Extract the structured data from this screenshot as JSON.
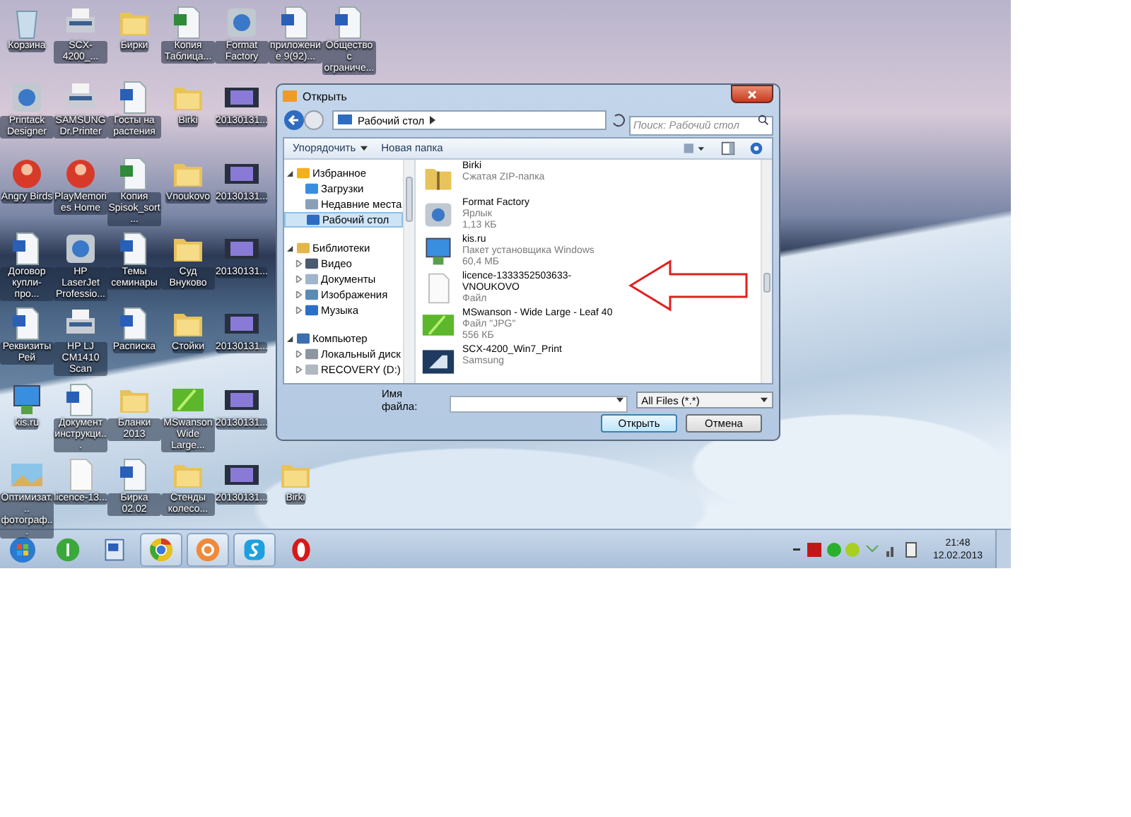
{
  "desktop": {
    "columns": [
      [
        {
          "label": "Корзина",
          "kind": "recycle"
        },
        {
          "label": "Printack Designer",
          "kind": "app"
        },
        {
          "label": "Angry Birds",
          "kind": "game"
        },
        {
          "label": "Договор купли-про...",
          "kind": "word"
        },
        {
          "label": "Реквизиты Рей",
          "kind": "word"
        },
        {
          "label": "kis.ru",
          "kind": "installer"
        },
        {
          "label": "Оптимизат... фотограф...",
          "kind": "image"
        }
      ],
      [
        {
          "label": "SCX-4200_...",
          "kind": "printer"
        },
        {
          "label": "SAMSUNG Dr.Printer",
          "kind": "printer"
        },
        {
          "label": "PlayMemories Home",
          "kind": "game"
        },
        {
          "label": "HP LaserJet Professio...",
          "kind": "app"
        },
        {
          "label": "HP LJ CM1410 Scan",
          "kind": "printer"
        },
        {
          "label": "Документ инструкци...",
          "kind": "word"
        },
        {
          "label": "licence-13...",
          "kind": "file"
        }
      ],
      [
        {
          "label": "Бирки",
          "kind": "folder"
        },
        {
          "label": "Госты на растения",
          "kind": "word"
        },
        {
          "label": "Копия Spisok_sort...",
          "kind": "excel"
        },
        {
          "label": "Темы семинары",
          "kind": "word"
        },
        {
          "label": "Расписка",
          "kind": "word"
        },
        {
          "label": "Бланки 2013",
          "kind": "folder"
        },
        {
          "label": "Бирка 02.02",
          "kind": "word"
        }
      ],
      [
        {
          "label": "Копия Таблица...",
          "kind": "excel"
        },
        {
          "label": "Birki",
          "kind": "folder"
        },
        {
          "label": "Vnoukovo",
          "kind": "folder"
        },
        {
          "label": "Суд Внуково",
          "kind": "folder"
        },
        {
          "label": "Стойки",
          "kind": "folder"
        },
        {
          "label": "MSwanson Wide Large...",
          "kind": "leaf"
        },
        {
          "label": "Стенды колесо...",
          "kind": "folder"
        }
      ],
      [
        {
          "label": "Format Factory",
          "kind": "app"
        },
        {
          "label": "20130131...",
          "kind": "video"
        },
        {
          "label": "20130131...",
          "kind": "video"
        },
        {
          "label": "20130131...",
          "kind": "video"
        },
        {
          "label": "20130131...",
          "kind": "video"
        },
        {
          "label": "20130131...",
          "kind": "video"
        },
        {
          "label": "20130131...",
          "kind": "video"
        }
      ],
      [
        {
          "label": "приложение 9(92)...",
          "kind": "word"
        },
        {
          "label": "Birki",
          "kind": "folder"
        }
      ],
      [
        {
          "label": "Общество с ограниче...",
          "kind": "word"
        }
      ]
    ]
  },
  "dialog": {
    "title": "Открыть",
    "address": "Рабочий стол",
    "search": {
      "placeholder": "Поиск: Рабочий стол"
    },
    "toolbar": [
      {
        "label": "Упорядочить",
        "dropdown": true
      },
      {
        "label": "Новая папка",
        "dropdown": false
      }
    ],
    "nav": [
      {
        "label": "Избранное",
        "kind": "star",
        "expanded": true,
        "selected": false,
        "children": [
          {
            "label": "Загрузки",
            "kind": "download",
            "selected": false
          },
          {
            "label": "Недавние места",
            "kind": "recent",
            "selected": false
          },
          {
            "label": "Рабочий стол",
            "kind": "desktop",
            "selected": true
          }
        ]
      },
      {
        "label": "Библиотеки",
        "kind": "library",
        "expanded": true,
        "selected": false,
        "children": [
          {
            "label": "Видео",
            "kind": "video",
            "selected": false,
            "expanded": false
          },
          {
            "label": "Документы",
            "kind": "docs",
            "selected": false,
            "expanded": false
          },
          {
            "label": "Изображения",
            "kind": "pictures",
            "selected": false,
            "expanded": false
          },
          {
            "label": "Музыка",
            "kind": "music",
            "selected": false,
            "expanded": false
          }
        ]
      },
      {
        "label": "Компьютер",
        "kind": "computer",
        "expanded": true,
        "selected": false,
        "children": [
          {
            "label": "Локальный диск",
            "kind": "disk",
            "selected": false,
            "expanded": false
          },
          {
            "label": "RECOVERY (D:)",
            "kind": "drive",
            "selected": false,
            "expanded": false
          }
        ]
      }
    ],
    "files": [
      {
        "name": "Birki",
        "details": [
          "Сжатая ZIP-папка"
        ],
        "kind": "zip"
      },
      {
        "name": "Format Factory",
        "details": [
          "Ярлык",
          "1,13 КБ"
        ],
        "kind": "shortcut"
      },
      {
        "name": "kis.ru",
        "details": [
          "Пакет установщика Windows",
          "60,4 МБ"
        ],
        "kind": "installer"
      },
      {
        "name": "licence-1333352503633-VNOUKOVO",
        "details": [
          "Файл"
        ],
        "kind": "file"
      },
      {
        "name": "MSwanson - Wide Large - Leaf 40",
        "details": [
          "Файл \"JPG\"",
          "556 КБ"
        ],
        "kind": "leaf"
      },
      {
        "name": "SCX-4200_Win7_Print",
        "details": [
          "Samsung"
        ],
        "kind": "printer"
      }
    ],
    "filename": {
      "label": "Имя файла:"
    },
    "filter": "All Files (*.*)",
    "buttons": [
      {
        "label": "Открыть",
        "default": true
      },
      {
        "label": "Отмена",
        "default": false
      }
    ]
  },
  "taskbar": {
    "apps": [
      {
        "kind": "antenna",
        "active": false
      },
      {
        "kind": "word",
        "active": false
      },
      {
        "kind": "browser",
        "active": true
      },
      {
        "kind": "mail",
        "active": true
      },
      {
        "kind": "chat",
        "active": true
      },
      {
        "kind": "opera",
        "active": false
      }
    ],
    "clock": {
      "time": "21:48",
      "date": "12.02.2013"
    }
  }
}
